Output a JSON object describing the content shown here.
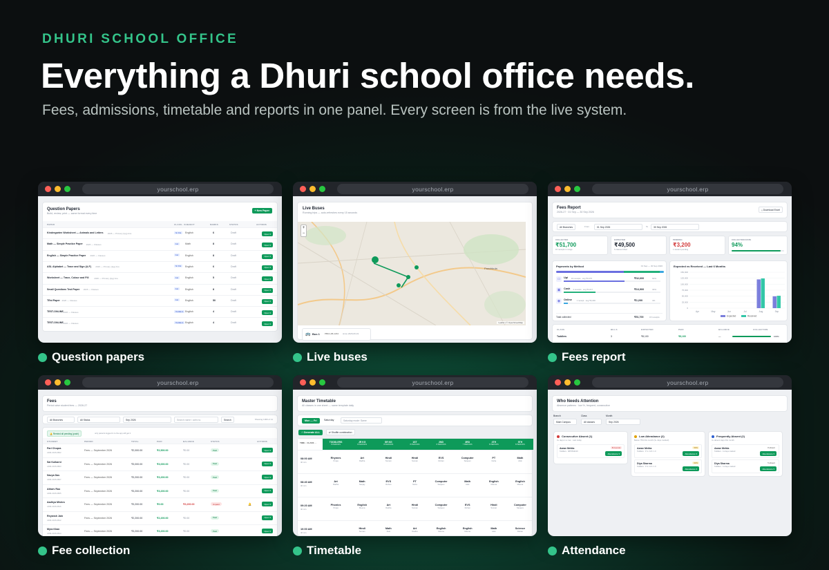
{
  "hero": {
    "eyebrow": "DHURI SCHOOL OFFICE",
    "title": "Everything a Dhuri school office needs.",
    "subtitle": "Fees, admissions, timetable and reports in one panel. Every screen is from the live system."
  },
  "browser_url": "yourschool.erp",
  "colors": {
    "accent": "#34c48a",
    "green_button": "#0e9a5a"
  },
  "cards": {
    "question_papers": {
      "caption": "Question papers",
      "title": "Question Papers",
      "subtitle": "Build, review, print — same format every time",
      "new_button": "+ New Paper",
      "headers": [
        "PAPER",
        "CLASS · SUBJECT",
        "MARKS",
        "STATUS",
        "ACTIONS"
      ],
      "rows": [
        {
          "paper": "Kindergarten Worksheet — Animals and Letters",
          "meta": "2026 — Primary (Ipg) Ans",
          "cls": "Sr KG",
          "subject": "English",
          "marks": "6",
          "status": "Draft"
        },
        {
          "paper": "Math — Simple Practice Paper",
          "meta": "2026 — Classes",
          "cls": "1st",
          "subject": "Math",
          "marks": "8",
          "status": "Draft"
        },
        {
          "paper": "English — Simple Practice Paper",
          "meta": "2026 — Classes",
          "cls": "1st",
          "subject": "English",
          "marks": "8",
          "status": "Draft"
        },
        {
          "paper": "ASL Alphabet — Trace and Sign (A-F)",
          "meta": "2026 — Primary (Ipg) Ans",
          "cls": "Sr KG",
          "subject": "English",
          "marks": "6",
          "status": "Draft"
        },
        {
          "paper": "Worksheet — Trace, Colour and Fill",
          "meta": "2026 — Primary (Ipg) Ans",
          "cls": "1st",
          "subject": "English",
          "marks": "5",
          "status": "Draft"
        },
        {
          "paper": "Small Questions Test Paper",
          "meta": "2026 — Classes",
          "cls": "1st",
          "subject": "English",
          "marks": "8",
          "status": "Draft"
        },
        {
          "paper": "TEst Paper",
          "meta": "2026 — Classes",
          "cls": "1st",
          "subject": "English",
          "marks": "50",
          "status": "Draft"
        },
        {
          "paper": "TEST-ONLINE",
          "meta": "2026 — Classes",
          "cls": "Toddlers",
          "subject": "English",
          "marks": "4",
          "status": "Draft"
        },
        {
          "paper": "TEST-ONLINE",
          "meta": "2026 — Classes",
          "cls": "Toddlers",
          "subject": "English",
          "marks": "4",
          "status": "Draft"
        }
      ],
      "open_label": "Open ▾"
    },
    "live_buses": {
      "caption": "Live buses",
      "title": "Live Buses",
      "subtitle": "Running trips — auto-refreshes every 15 seconds",
      "zoom_in": "+",
      "zoom_out": "−",
      "map_label": "Panchkula",
      "attribution": "Leaflet | © OpenStreetMap",
      "bus_name": "Bus 1",
      "bus_reg": "PB10-AB-1234",
      "bus_time": "since 2026-09-19"
    },
    "fees_report": {
      "caption": "Fees report",
      "title": "Fees Report",
      "subtitle": "2026-27 · 01 Sep — 30 Sep 2026",
      "download": "Download Excel",
      "branch": "All Branches",
      "from_label": "From",
      "from_date": "01 Sep 2026",
      "to_label": "To",
      "to_date": "30 Sep 2026",
      "kpis": [
        {
          "label": "COLLECTED",
          "value": "₹51,700",
          "note": "15 receipts in range",
          "color": "#0e9a5a"
        },
        {
          "label": "EXPECTED",
          "value": "₹49,500",
          "note": "6 classes billed",
          "color": "#1d2430"
        },
        {
          "label": "PENDING",
          "value": "₹3,200",
          "note": "1 student pending",
          "color": "#d23b3b"
        },
        {
          "label": "COLLECTION RATE",
          "value": "94%",
          "note": "",
          "color": "#0e9a5a"
        }
      ],
      "methods_title": "Payments by Method",
      "methods_range": "01 Sep — 30 Sep 2026",
      "methods": [
        {
          "name": "Upi",
          "note": "10 receipts · avg ₹3,270",
          "amount": "₹32,600",
          "pct": "63%"
        },
        {
          "name": "Cash",
          "note": "4 receipts · avg ₹4,217",
          "amount": "₹16,900",
          "pct": "33%"
        },
        {
          "name": "Online",
          "note": "1 receipt · avg ₹2,200",
          "amount": "₹2,200",
          "pct": "4%"
        }
      ],
      "total_label": "Total collected",
      "total_value": "₹51,700",
      "total_note": "15 receipts",
      "chart_title": "Expected vs Received — Last 6 Months",
      "table_headers": [
        "CLASS",
        "BILLS",
        "EXPECTED",
        "PAID",
        "BALANCE",
        "COLLECTION"
      ],
      "table_row": {
        "cls": "Toddlers",
        "bills": "3",
        "expected": "₹8,100",
        "paid": "₹8,100",
        "balance": "—",
        "collection": "100%"
      }
    },
    "fee_collection": {
      "caption": "Fee collection",
      "title": "Fees",
      "subtitle": "Period-wise student fees — 2026-27",
      "branch_filter": "All Branches",
      "status_filter": "All Status",
      "month_filter": "Sep 2026",
      "search_placeholder": "Search name / adm no.",
      "search_button": "Search",
      "showing": "Showing 1000 of 11",
      "remind_button": "Remind all pending (push)",
      "remind_note": "only parents logged in to the app will get it",
      "headers": [
        "STUDENT",
        "PERIOD",
        "TOTAL",
        "PAID",
        "BALANCE",
        "STATUS",
        "ACTIONS"
      ],
      "rows": [
        {
          "name": "Pari Chopra",
          "adm": "ADM-2026-9802",
          "period": "Fees — September 2026",
          "total": "₹2,000.00",
          "paid": "₹2,500.00",
          "balance": "₹0.00",
          "status": "Paid"
        },
        {
          "name": "Sai Kulkarni",
          "adm": "ADM-2026-9803",
          "period": "Fees — September 2026",
          "total": "₹3,000.00",
          "paid": "₹3,000.00",
          "balance": "₹0.00",
          "status": "Paid"
        },
        {
          "name": "Navya Das",
          "adm": "ADM-2026-9807",
          "period": "Fees — September 2026",
          "total": "₹3,200.00",
          "paid": "₹3,200.00",
          "balance": "₹0.00",
          "status": "Paid"
        },
        {
          "name": "Atharv Rao",
          "adm": "ADM-2026-9805",
          "period": "Fees — September 2026",
          "total": "₹3,200.00",
          "paid": "₹3,200.00",
          "balance": "₹0.00",
          "status": "Paid"
        },
        {
          "name": "Aadhya Mishra",
          "adm": "ADM-2026-9816",
          "period": "Fees — September 2026",
          "total": "₹3,200.00",
          "paid": "₹0.00",
          "balance": "₹3,200.00",
          "status": "Unpaid"
        },
        {
          "name": "Reyansh Jain",
          "adm": "ADM-2026-9812",
          "period": "Fees — September 2026",
          "total": "₹2,200.00",
          "paid": "₹2,200.00",
          "balance": "₹0.00",
          "status": "Paid"
        },
        {
          "name": "Myra Khan",
          "adm": "ADM-2026-9814",
          "period": "Fees — September 2026",
          "total": "₹3,200.00",
          "paid": "₹3,200.00",
          "balance": "₹0.00",
          "status": "Paid"
        }
      ],
      "open_label": "Open ▾"
    },
    "timetable": {
      "caption": "Timetable",
      "title": "Master Timetable",
      "subtitle": "All classes in one sheet — same template daily",
      "tab_weekday": "Mon — Fri",
      "tab_saturday": "Saturday",
      "saturday_note": "Saturday mode: Same",
      "generate_button": "Generate ALL",
      "shuffle_button": "Shuffle combination",
      "corner": "TIME ↓ CLASS →",
      "classes": [
        {
          "name": "TODDLERS",
          "periods": "8 PERIODS"
        },
        {
          "name": "JR KG",
          "periods": "8 PERIODS"
        },
        {
          "name": "SR KG",
          "periods": "8 PERIODS"
        },
        {
          "name": "1ST",
          "periods": "8 PERIODS"
        },
        {
          "name": "2ND",
          "periods": "8 PERIODS"
        },
        {
          "name": "3RD",
          "periods": "7 PERIODS"
        },
        {
          "name": "4TH",
          "periods": "8 PERIODS"
        },
        {
          "name": "5TH",
          "periods": "8 PERIODS"
        }
      ],
      "slots": [
        {
          "time": "08:00 AM",
          "dur": "40 min",
          "cells": [
            [
              "Rhymes",
              "Pooja"
            ],
            [
              "Art",
              "Radha"
            ],
            [
              "Hindi",
              "Suman"
            ],
            [
              "Hindi",
              "Suman"
            ],
            [
              "EVS",
              "Rohan"
            ],
            [
              "Computer",
              "Sanjeev"
            ],
            [
              "PT",
              "Neha"
            ],
            [
              "Math",
              "Alok"
            ]
          ]
        },
        {
          "time": "08:40 AM",
          "dur": "40 min",
          "cells": [
            [
              "Art",
              "Radha"
            ],
            [
              "Math",
              "Sanjay"
            ],
            [
              "EVS",
              "Rohan"
            ],
            [
              "PT",
              "Neha"
            ],
            [
              "Computer",
              "Sanjeev"
            ],
            [
              "Math",
              "Alok"
            ],
            [
              "English",
              "Meena"
            ],
            [
              "English",
              "Meena"
            ]
          ]
        },
        {
          "time": "09:20 AM",
          "dur": "40 min",
          "cells": [
            [
              "Phonics",
              "Pooja"
            ],
            [
              "English",
              "Meena"
            ],
            [
              "Art",
              "Radha"
            ],
            [
              "Hindi",
              "Suman"
            ],
            [
              "Computer",
              "Sanjeev"
            ],
            [
              "EVS",
              "Rohan"
            ],
            [
              "Hindi",
              "Suman"
            ],
            [
              "Computer",
              "Sanjeev"
            ]
          ]
        },
        {
          "time": "10:00 AM",
          "dur": "40 min",
          "cells": [
            [
              "",
              ""
            ],
            [
              "Hindi",
              "Suman"
            ],
            [
              "Math",
              "Alok"
            ],
            [
              "Art",
              "Radha"
            ],
            [
              "English",
              "Meena"
            ],
            [
              "English",
              "Meena"
            ],
            [
              "Math",
              "Alok"
            ],
            [
              "Science",
              "Rohan"
            ]
          ]
        }
      ]
    },
    "attendance": {
      "caption": "Attendance",
      "title": "Who Needs Attention",
      "subtitle": "Absence patterns · low %, frequent, consecutive",
      "branch_label": "Branch",
      "branch_value": "Main Campus",
      "class_label": "Class",
      "class_value": "All classes",
      "month_label": "Month",
      "month_value": "Sep 2026",
      "attendance_btn": "Attendance ▾",
      "groups": [
        {
          "title": "Consecutive Absent (1)",
          "note": "3+ days in a row · Last today",
          "color": "#d23b3b",
          "items": [
            {
              "name": "Aarav Mehta",
              "cls": "Toddlers · 9876543210",
              "badge": "8 in a row"
            }
          ]
        },
        {
          "title": "Low Attendance (2)",
          "note": "Below 75% this month (3+ days marked)",
          "color": "#e0a100",
          "items": [
            {
              "name": "Aarav Mehta",
              "cls": "Toddlers · P 1 / A 8 / L 0",
              "badge": "50%"
            },
            {
              "name": "Diya Sharma",
              "cls": "Toddlers · P 4 / A 5 / L 0",
              "badge": "62%"
            }
          ]
        },
        {
          "title": "Frequently Absent (2)",
          "note": "3+ absent days this month",
          "color": "#2d5fd0",
          "items": [
            {
              "name": "Aarav Mehta",
              "cls": "Toddlers · 11 days marked",
              "badge": "8 absent"
            },
            {
              "name": "Diya Sharma",
              "cls": "Toddlers · 11 days marked",
              "badge": "5 absent"
            }
          ]
        }
      ]
    }
  },
  "chart_data": {
    "type": "bar",
    "title": "Expected vs Received — Last 6 Months",
    "categories": [
      "Apr",
      "May",
      "Jun",
      "Jul",
      "Aug",
      "Sep"
    ],
    "series": [
      {
        "name": "Expected",
        "values": [
          0,
          0,
          0,
          0,
          120000,
          49500
        ]
      },
      {
        "name": "Received",
        "values": [
          0,
          0,
          0,
          0,
          124000,
          51700
        ]
      }
    ],
    "yticks": [
      "150,000",
      "125,000",
      "100,000",
      "75,000",
      "50,000",
      "25,000",
      "0"
    ],
    "ylim": [
      0,
      150000
    ],
    "legend": "bottom",
    "colors": {
      "Expected": "#7b7fdc",
      "Received": "#33c7a8"
    }
  }
}
